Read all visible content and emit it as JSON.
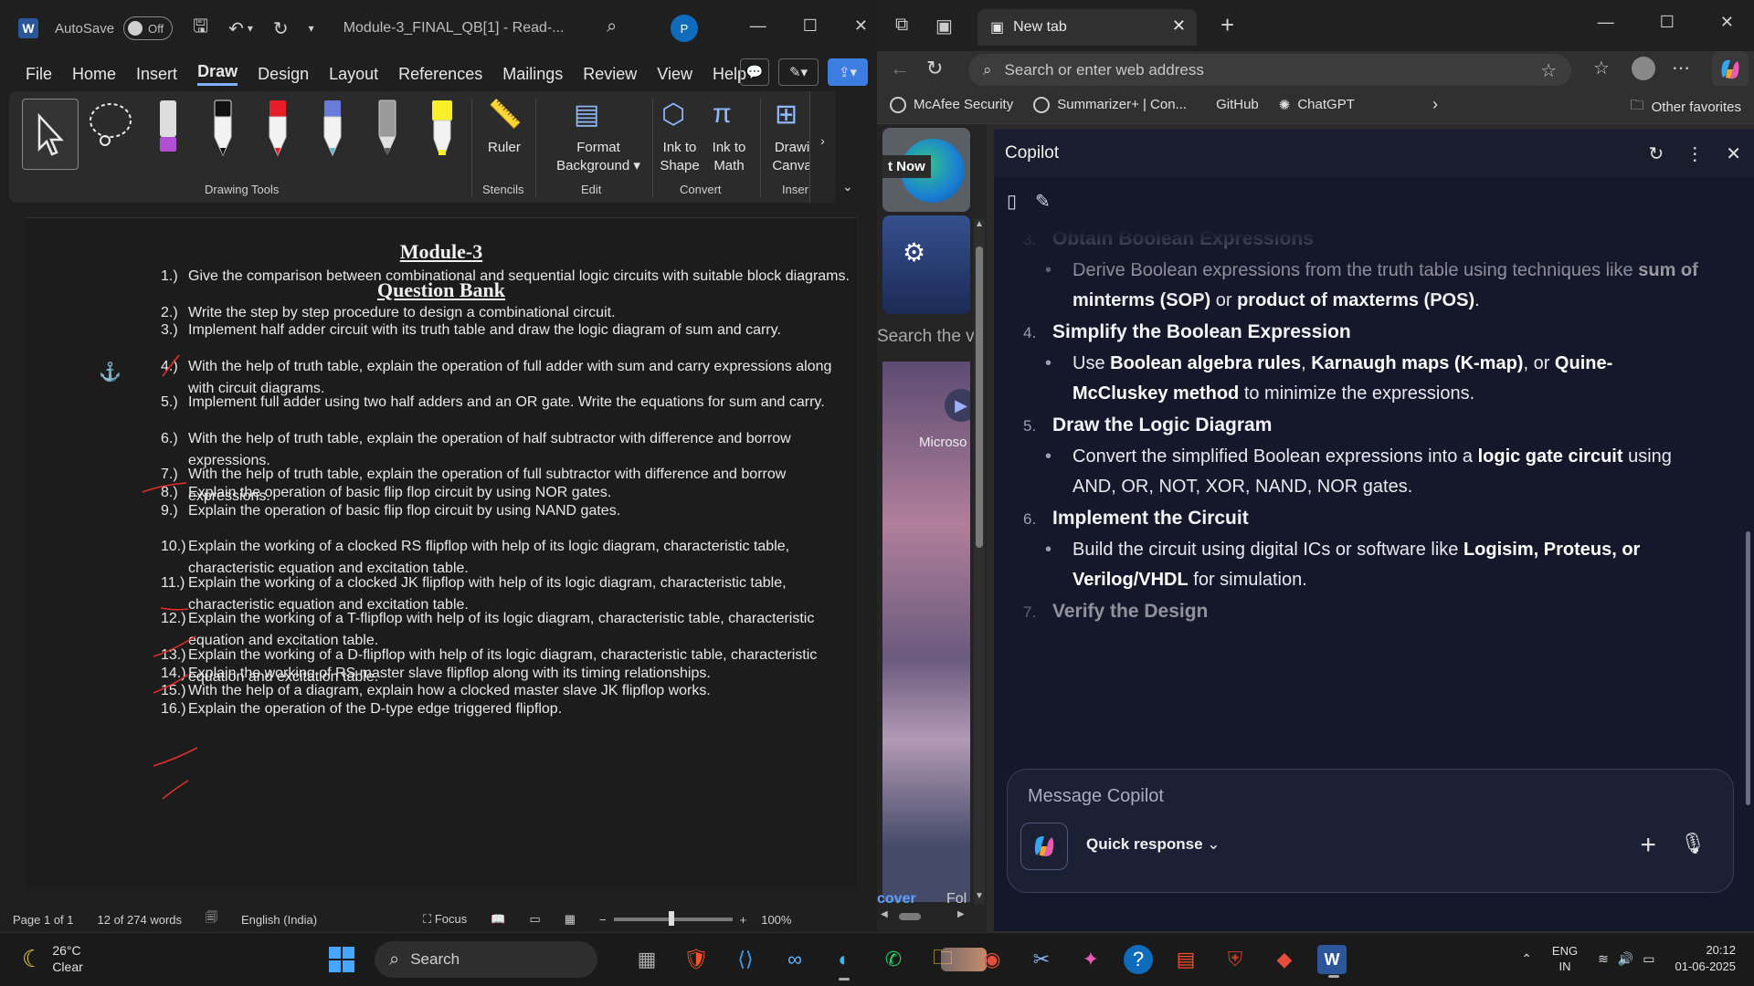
{
  "word": {
    "title_bar": {
      "autosave": "AutoSave",
      "toggle": "Off",
      "doc_title": "Module-3_FINAL_QB[1]  -  Read-...",
      "avatar": "P"
    },
    "menu": [
      "File",
      "Home",
      "Insert",
      "Draw",
      "Design",
      "Layout",
      "References",
      "Mailings",
      "Review",
      "View",
      "Help"
    ],
    "ribbon": {
      "group_drawing_tools": "Drawing Tools",
      "ruler": "Ruler",
      "group_stencils": "Stencils",
      "format_bg_1": "Format",
      "format_bg_2": "Background",
      "group_edit": "Edit",
      "ink_shape_1": "Ink to",
      "ink_shape_2": "Shape",
      "ink_math_1": "Ink to",
      "ink_math_2": "Math",
      "group_convert": "Convert",
      "drawing_canvas_1": "Drawi",
      "drawing_canvas_2": "Canva",
      "group_insert": "Inser"
    },
    "doc": {
      "heading": "Module-3",
      "subheading": "Question Bank",
      "questions": [
        {
          "n": "1.)",
          "t": "Give the comparison between combinational and sequential logic circuits with suitable block diagrams."
        },
        {
          "n": "2.)",
          "t": "Write the step by step procedure to design a combinational circuit."
        },
        {
          "n": "3.)",
          "t": "Implement half adder circuit with its truth table and draw the logic diagram of sum and carry."
        },
        {
          "n": "4.)",
          "t": "With the help of truth table, explain the operation of full adder with sum and carry expressions along with circuit diagrams."
        },
        {
          "n": "5.)",
          "t": "Implement full adder using two half adders and an OR gate. Write the equations for sum and carry."
        },
        {
          "n": "6.)",
          "t": "With the help of truth table, explain the operation of half subtractor with difference and borrow expressions."
        },
        {
          "n": "7.)",
          "t": "With the help of truth table, explain the operation of full subtractor with difference and borrow expressions."
        },
        {
          "n": "8.)",
          "t": "Explain the operation of basic flip flop circuit by using NOR gates."
        },
        {
          "n": "9.)",
          "t": "Explain the operation of basic flip flop circuit by using NAND gates."
        },
        {
          "n": "10.)",
          "t": "Explain the working of a clocked RS flipflop with help of its logic diagram, characteristic table, characteristic equation and excitation table."
        },
        {
          "n": "11.)",
          "t": "Explain the working of a clocked JK flipflop with help of its logic diagram, characteristic table, characteristic equation and excitation table."
        },
        {
          "n": "12.)",
          "t": "Explain the working of a T-flipflop with help of its logic diagram, characteristic table, characteristic equation and excitation table."
        },
        {
          "n": "13.)",
          "t": "Explain the working of a D-flipflop with help of its logic diagram, characteristic table, characteristic equation and excitation table."
        },
        {
          "n": "14.)",
          "t": "Explain the working of RS master slave flipflop along with its timing relationships."
        },
        {
          "n": "15.)",
          "t": "With the help of a diagram, explain how a clocked master slave JK flipflop works."
        },
        {
          "n": "16.)",
          "t": "Explain the operation of the D-type edge triggered flipflop."
        }
      ]
    },
    "status": {
      "page": "Page 1 of 1",
      "words": "12 of 274 words",
      "lang": "English (India)",
      "focus": "Focus",
      "zoom": "100%"
    }
  },
  "edge": {
    "tab_title": "New tab",
    "address_placeholder": "Search or enter web address",
    "favorites": [
      "McAfee Security",
      "Summarizer+ | Con...",
      "GitHub",
      "ChatGPT"
    ],
    "other_favorites": "Other favorites",
    "ntp": {
      "get_now": "t Now",
      "search_partial": "Search the v",
      "ms_label": "Microso",
      "discover": "cover",
      "follow": "Fol"
    },
    "copilot": {
      "title": "Copilot",
      "steps": [
        {
          "n": "3.",
          "title": "Obtain Boolean Expressions",
          "bullet_html": "Derive Boolean expressions from the truth table using techniques like <b>sum of minterms (SOP)</b> or <b>product of maxterms (POS)</b>."
        },
        {
          "n": "4.",
          "title": "Simplify the Boolean Expression",
          "bullet_html": "Use <b>Boolean algebra rules</b>, <b>Karnaugh maps (K-map)</b>, or <b>Quine-McCluskey method</b> to minimize the expressions."
        },
        {
          "n": "5.",
          "title": "Draw the Logic Diagram",
          "bullet_html": "Convert the simplified Boolean expressions into a <b>logic gate circuit</b> using AND, OR, NOT, XOR, NAND, NOR gates."
        },
        {
          "n": "6.",
          "title": "Implement the Circuit",
          "bullet_html": "Build the circuit using digital ICs or software like <b>Logisim, Proteus, or Verilog/VHDL</b> for simulation."
        },
        {
          "n": "7.",
          "title": "Verify the Design"
        }
      ],
      "input_placeholder": "Message Copilot",
      "mode": "Quick response"
    }
  },
  "taskbar": {
    "temp": "26°C",
    "condition": "Clear",
    "search": "Search",
    "lang1": "ENG",
    "lang2": "IN",
    "time": "20:12",
    "date": "01-06-2025"
  }
}
